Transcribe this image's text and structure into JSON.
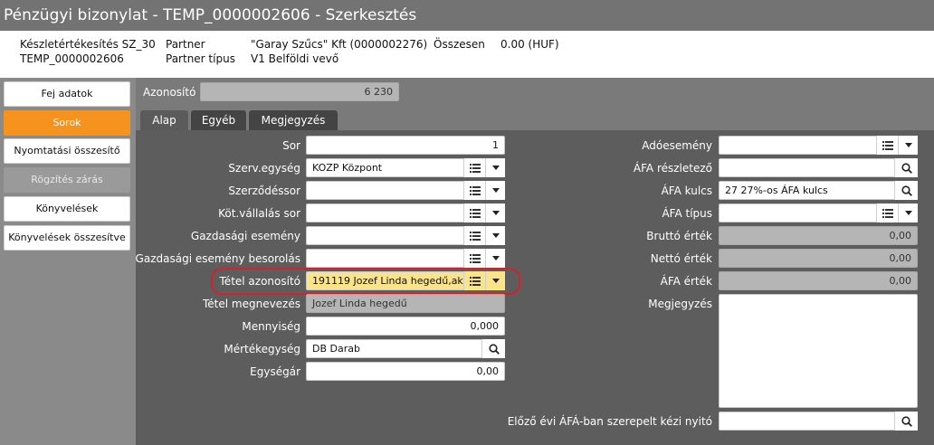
{
  "window": {
    "title": "Pénzügyi bizonylat - TEMP_0000002606 - Szerkesztés"
  },
  "header": {
    "doc_type": "Készletértékesítés SZ_30",
    "doc_id": "TEMP_0000002606",
    "partner_label": "Partner",
    "partner_type_label": "Partner típus",
    "partner_value": "\"Garay Szűcs\" Kft (0000002276)",
    "partner_type_value": "V1 Belföldi vevő",
    "total_label": "Összesen",
    "total_value": "0.00 (HUF)"
  },
  "sidebar": {
    "items": [
      {
        "label": "Fej adatok",
        "state": "normal"
      },
      {
        "label": "Sorok",
        "state": "active"
      },
      {
        "label": "Nyomtatási összesítő",
        "state": "normal"
      },
      {
        "label": "Rögzítés zárás",
        "state": "disabled"
      },
      {
        "label": "Könyvelések",
        "state": "normal"
      },
      {
        "label": "Könyvelések összesítve",
        "state": "normal"
      }
    ]
  },
  "main": {
    "id_label": "Azonosító",
    "id_value": "6 230",
    "tabs": [
      {
        "label": "Alap"
      },
      {
        "label": "Egyéb"
      },
      {
        "label": "Megjegyzés"
      }
    ],
    "left_fields": {
      "sor": {
        "label": "Sor",
        "value": "1"
      },
      "szerv": {
        "label": "Szerv.egység",
        "value": "KOZP Központ"
      },
      "szerz": {
        "label": "Szerződéssor",
        "value": ""
      },
      "kot": {
        "label": "Köt.vállalás sor",
        "value": ""
      },
      "gazd": {
        "label": "Gazdasági esemény",
        "value": ""
      },
      "gazdbes": {
        "label": "Gazdasági esemény besorolás",
        "value": ""
      },
      "tetel": {
        "label": "Tétel azonosító",
        "value": "191119 Jozef Linda hegedű,ak"
      },
      "tetelnev": {
        "label": "Tétel megnevezés",
        "value": "Jozef Linda hegedű"
      },
      "menny": {
        "label": "Mennyiség",
        "value": "0,000"
      },
      "mert": {
        "label": "Mértékegység",
        "value": "DB Darab"
      },
      "egys": {
        "label": "Egységár",
        "value": "0,00"
      }
    },
    "right_fields": {
      "adoes": {
        "label": "Adóesemény",
        "value": ""
      },
      "afareszl": {
        "label": "ÁFA részletező",
        "value": ""
      },
      "afakulcs": {
        "label": "ÁFA kulcs",
        "value": "27 27%-os ÁFA kulcs"
      },
      "afatipus": {
        "label": "ÁFA típus",
        "value": ""
      },
      "brutto": {
        "label": "Bruttó érték",
        "value": "0,00"
      },
      "netto": {
        "label": "Nettó érték",
        "value": "0,00"
      },
      "afaert": {
        "label": "ÁFA érték",
        "value": "0,00"
      },
      "megj": {
        "label": "Megjegyzés",
        "value": ""
      },
      "elozo": {
        "label": "Előző évi ÁFÁ-ban szerepelt kézi nyitó",
        "value": ""
      }
    }
  },
  "colors": {
    "accent": "#f6921e",
    "highlight": "#fbe38a",
    "ring": "#d6202a"
  }
}
